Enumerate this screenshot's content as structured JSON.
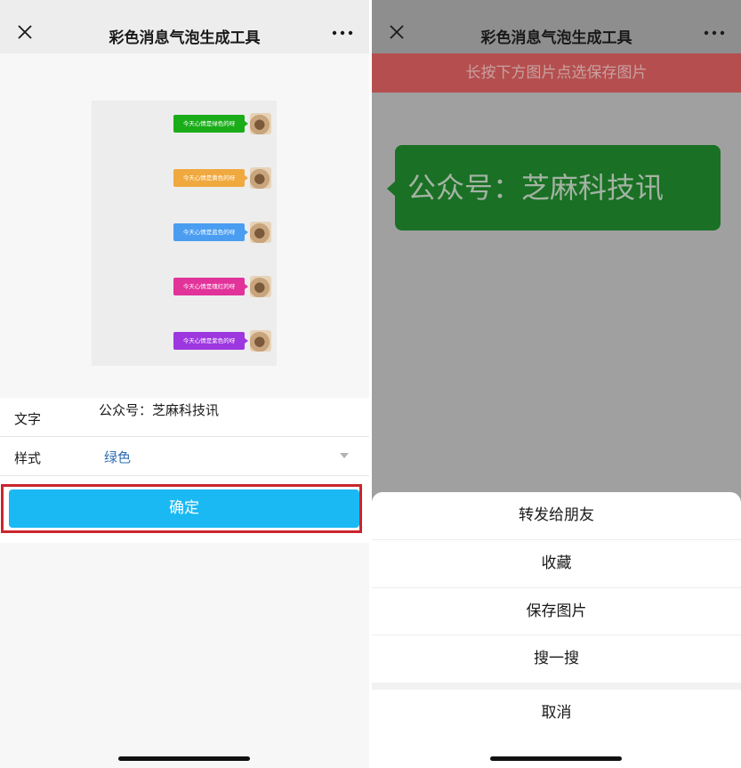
{
  "left": {
    "title": "彩色消息气泡生成工具",
    "close_icon": "close-icon",
    "more_icon": "more-dots-icon",
    "preview": [
      {
        "text": "今天心情是绿色的呀",
        "color": "#1aad19"
      },
      {
        "text": "今天心情是黄色的呀",
        "color": "#f0a93f"
      },
      {
        "text": "今天心情是蓝色的呀",
        "color": "#4a9df0"
      },
      {
        "text": "今天心情是瑰红的呀",
        "color": "#e2339a"
      },
      {
        "text": "今天心情是紫色的呀",
        "color": "#9d37e0"
      }
    ],
    "form": {
      "text_label": "文字",
      "text_value": "公众号：芝麻科技讯",
      "style_label": "样式",
      "style_value": "绿色"
    },
    "confirm_label": "确定"
  },
  "right": {
    "title": "彩色消息气泡生成工具",
    "banner": "长按下方图片点选保存图片",
    "bubble_text": "公众号：芝麻科技讯",
    "bubble_color": "#1a7024",
    "sheet": {
      "items": [
        "转发给朋友",
        "收藏",
        "保存图片",
        "搜一搜"
      ],
      "cancel": "取消"
    }
  }
}
